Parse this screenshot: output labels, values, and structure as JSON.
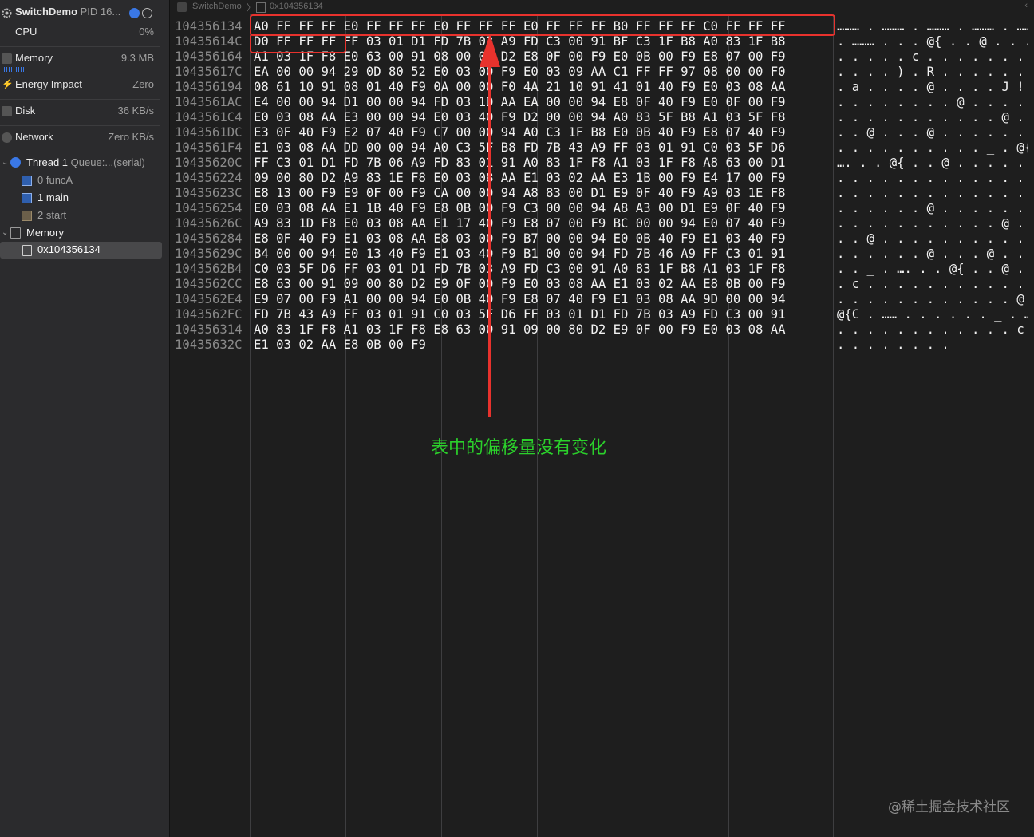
{
  "sidebar": {
    "process": {
      "name": "SwitchDemo",
      "pid": "PID 16..."
    },
    "gauges": [
      {
        "label": "CPU",
        "value": "0%"
      },
      {
        "label": "Memory",
        "value": "9.3 MB"
      },
      {
        "label": "Energy Impact",
        "value": "Zero"
      },
      {
        "label": "Disk",
        "value": "36 KB/s"
      },
      {
        "label": "Network",
        "value": "Zero KB/s"
      }
    ],
    "thread": {
      "name": "Thread 1",
      "queue": "Queue:...(serial)"
    },
    "frames": [
      {
        "index": "0",
        "name": "funcA"
      },
      {
        "index": "1",
        "name": "main"
      },
      {
        "index": "2",
        "name": "start"
      }
    ],
    "memory_group": "Memory",
    "memory_item": "0x104356134"
  },
  "jumpbar": {
    "app": "SwitchDemo",
    "address": "0x104356134"
  },
  "hex": {
    "addresses": [
      "104356134",
      "10435614C",
      "104356164",
      "10435617C",
      "104356194",
      "1043561AC",
      "1043561C4",
      "1043561DC",
      "1043561F4",
      "10435620C",
      "104356224",
      "10435623C",
      "104356254",
      "10435626C",
      "104356284",
      "10435629C",
      "1043562B4",
      "1043562CC",
      "1043562E4",
      "1043562FC",
      "104356314",
      "10435632C"
    ],
    "rows": [
      "A0 FF FF FF E0 FF FF FF E0 FF FF FF E0 FF FF FF B0 FF FF FF C0 FF FF FF",
      "D0 FF FF FF FF 03 01 D1 FD 7B 03 A9 FD C3 00 91 BF C3 1F B8 A0 83 1F B8",
      "A1 03 1F F8 E0 63 00 91 08 00 00 D2 E8 0F 00 F9 E0 0B 00 F9 E8 07 00 F9",
      "EA 00 00 94 29 0D 80 52 E0 03 00 F9 E0 03 09 AA C1 FF FF 97 08 00 00 F0",
      "08 61 10 91 08 01 40 F9 0A 00 00 F0 4A 21 10 91 41 01 40 F9 E0 03 08 AA",
      "E4 00 00 94 D1 00 00 94 FD 03 1D AA EA 00 00 94 E8 0F 40 F9 E0 0F 00 F9",
      "E0 03 08 AA E3 00 00 94 E0 03 40 F9 D2 00 00 94 A0 83 5F B8 A1 03 5F F8",
      "E3 0F 40 F9 E2 07 40 F9 C7 00 00 94 A0 C3 1F B8 E0 0B 40 F9 E8 07 40 F9",
      "E1 03 08 AA DD 00 00 94 A0 C3 5F B8 FD 7B 43 A9 FF 03 01 91 C0 03 5F D6",
      "FF C3 01 D1 FD 7B 06 A9 FD 83 01 91 A0 83 1F F8 A1 03 1F F8 A8 63 00 D1",
      "09 00 80 D2 A9 83 1E F8 E0 03 08 AA E1 03 02 AA E3 1B 00 F9 E4 17 00 F9",
      "E8 13 00 F9 E9 0F 00 F9 CA 00 00 94 A8 83 00 D1 E9 0F 40 F9 A9 03 1E F8",
      "E0 03 08 AA E1 1B 40 F9 E8 0B 00 F9 C3 00 00 94 A8 A3 00 D1 E9 0F 40 F9",
      "A9 83 1D F8 E0 03 08 AA E1 17 40 F9 E8 07 00 F9 BC 00 00 94 E0 07 40 F9",
      "E8 0F 40 F9 E1 03 08 AA E8 03 00 F9 B7 00 00 94 E0 0B 40 F9 E1 03 40 F9",
      "B4 00 00 94 E0 13 40 F9 E1 03 40 F9 B1 00 00 94 FD 7B 46 A9 FF C3 01 91",
      "C0 03 5F D6 FF 03 01 D1 FD 7B 03 A9 FD C3 00 91 A0 83 1F B8 A1 03 1F F8",
      "E8 63 00 91 09 00 80 D2 E9 0F 00 F9 E0 03 08 AA E1 03 02 AA E8 0B 00 F9",
      "E9 07 00 F9 A1 00 00 94 E0 0B 40 F9 E8 07 40 F9 E1 03 08 AA 9D 00 00 94",
      "FD 7B 43 A9 FF 03 01 91 C0 03 5F D6 FF 03 01 D1 FD 7B 03 A9 FD C3 00 91",
      "A0 83 1F F8 A1 03 1F F8 E8 63 00 91 09 00 80 D2 E9 0F 00 F9 E0 03 08 AA",
      "E1 03 02 AA E8 0B 00 F9"
    ],
    "ascii": [
      "……… . ……… . ……… . ……… . ……… . ………",
      ". ……… . . . @{ . . @ . . . . . . . . .",
      ". . . . . c . . . . . . . . . . . . . . .",
      ". . . . ) . R . . . . . . . …… . . . . .",
      ". a . . . . @ . . . . J ! . . A . @ . . . .",
      ". . . . . . . . @ . . . . . . . . . @ . . . .",
      ". . . . . . . . . . . @ . . . . . . _ . . . _",
      ". . @ . . . @ . . . . . . . . . . @ . . . @ .",
      ". . . . . . . . . . _ . @{C . …… . . . . _",
      "…. . . @{ . . @ . . . . . . . . . . . . c . .",
      ". . . . . . . . . . . . . . . . . . . . . . . .",
      ". . . . . . . . . . . . . . . . . . . @ . . . .",
      ". . . . . . @ . . . . . . . . . . . . . . . @ .",
      ". . . . . . . . . . . @ . . . . . . . . . . @ .",
      ". . @ . . . . . . . . . . . . . . . @ . . . @ .",
      ". . . . . . @ . . . @ . . . . . @{F . ……",
      ". . _ . …. . . @{ . . @ . . . . . . . . .",
      ". c . . . . . . . . . . . . . . . . . . . . . .",
      ". . . . . . . . . . . . @ . . . @ . . . . . . .",
      "@{C . …… . . . . . . _ . …… . @{ . . @ . . .",
      ". . . . . . . . . . . . c . . . . . . . . . . .",
      ". . . . . . . ."
    ]
  },
  "annotation": "表中的偏移量没有变化",
  "watermark": "@稀土掘金技术社区",
  "colors": {
    "highlight": "#e8322d",
    "annotation": "#2bd02b",
    "accent": "#3a78e6"
  }
}
